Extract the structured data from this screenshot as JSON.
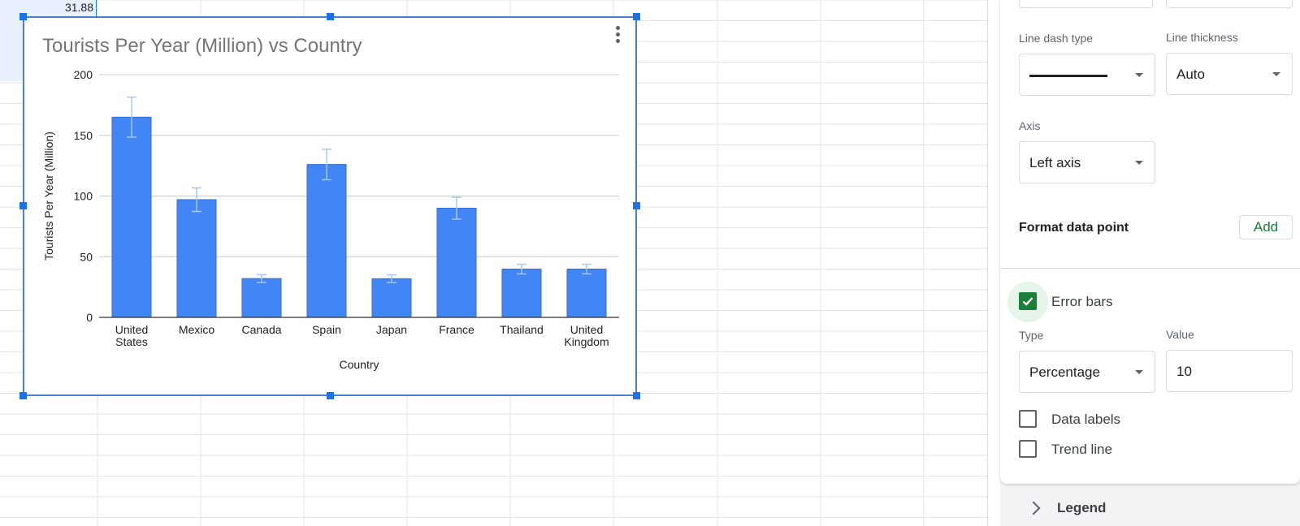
{
  "sheet": {
    "visible_cell_value": "31.88"
  },
  "chart_data": {
    "type": "bar",
    "title": "Tourists Per Year (Million) vs Country",
    "xlabel": "Country",
    "ylabel": "Tourists Per Year (Million)",
    "categories": [
      "United States",
      "Mexico",
      "Canada",
      "Spain",
      "Japan",
      "France",
      "Thailand",
      "United Kingdom"
    ],
    "category_lines": [
      [
        "United",
        "States"
      ],
      [
        "Mexico"
      ],
      [
        "Canada"
      ],
      [
        "Spain"
      ],
      [
        "Japan"
      ],
      [
        "France"
      ],
      [
        "Thailand"
      ],
      [
        "United",
        "Kingdom"
      ]
    ],
    "values": [
      165,
      97,
      32,
      126,
      31.88,
      90,
      39.8,
      39.8
    ],
    "error_bars": {
      "type": "Percentage",
      "value": 10
    },
    "ylim": [
      0,
      200
    ],
    "yticks": [
      0,
      50,
      100,
      150,
      200
    ],
    "grid": true,
    "legend": "none",
    "bar_color": "#4285f4",
    "error_bar_color": "#a8c7fa"
  },
  "panel": {
    "line_dash_label": "Line dash type",
    "line_thickness_label": "Line thickness",
    "line_thickness_value": "Auto",
    "axis_label": "Axis",
    "axis_value": "Left axis",
    "format_data_point_label": "Format data point",
    "add_label": "Add",
    "error_bars_label": "Error bars",
    "error_bars_checked": true,
    "type_label": "Type",
    "type_value": "Percentage",
    "value_label": "Value",
    "value_value": "10",
    "data_labels_label": "Data labels",
    "trend_line_label": "Trend line",
    "legend_section": "Legend",
    "accent_color": "#188038"
  }
}
